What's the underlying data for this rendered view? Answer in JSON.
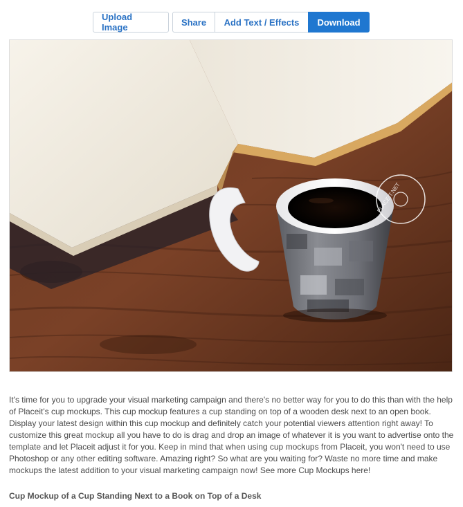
{
  "toolbar": {
    "upload_label": "Upload Image",
    "share_label": "Share",
    "effects_label": "Add Text / Effects",
    "download_label": "Download"
  },
  "mockup": {
    "watermark": "PLACEIT.NET"
  },
  "content": {
    "description": "It's time for you to upgrade your visual marketing campaign and there's no better way for you to do this than with the help of Placeit's cup mockups. This cup mockup features a cup standing on top of a wooden desk next to an open book. Display your latest design within this cup mockup and definitely catch your potential viewers attention right away! To customize this great mockup all you have to do is drag and drop an image of whatever it is you want to advertise onto the template and let Placeit adjust it for you. Keep in mind that when using cup mockups from Placeit, you won't need to use Photoshop or any other editing software. Amazing right? So what are you waiting for? Waste no more time and make mockups the latest addition to your visual marketing campaign now! See more Cup Mockups here!",
    "title": "Cup Mockup of a Cup Standing Next to a Book on Top of a Desk"
  },
  "colors": {
    "accent": "#1f77d0",
    "link": "#2a72c4"
  }
}
